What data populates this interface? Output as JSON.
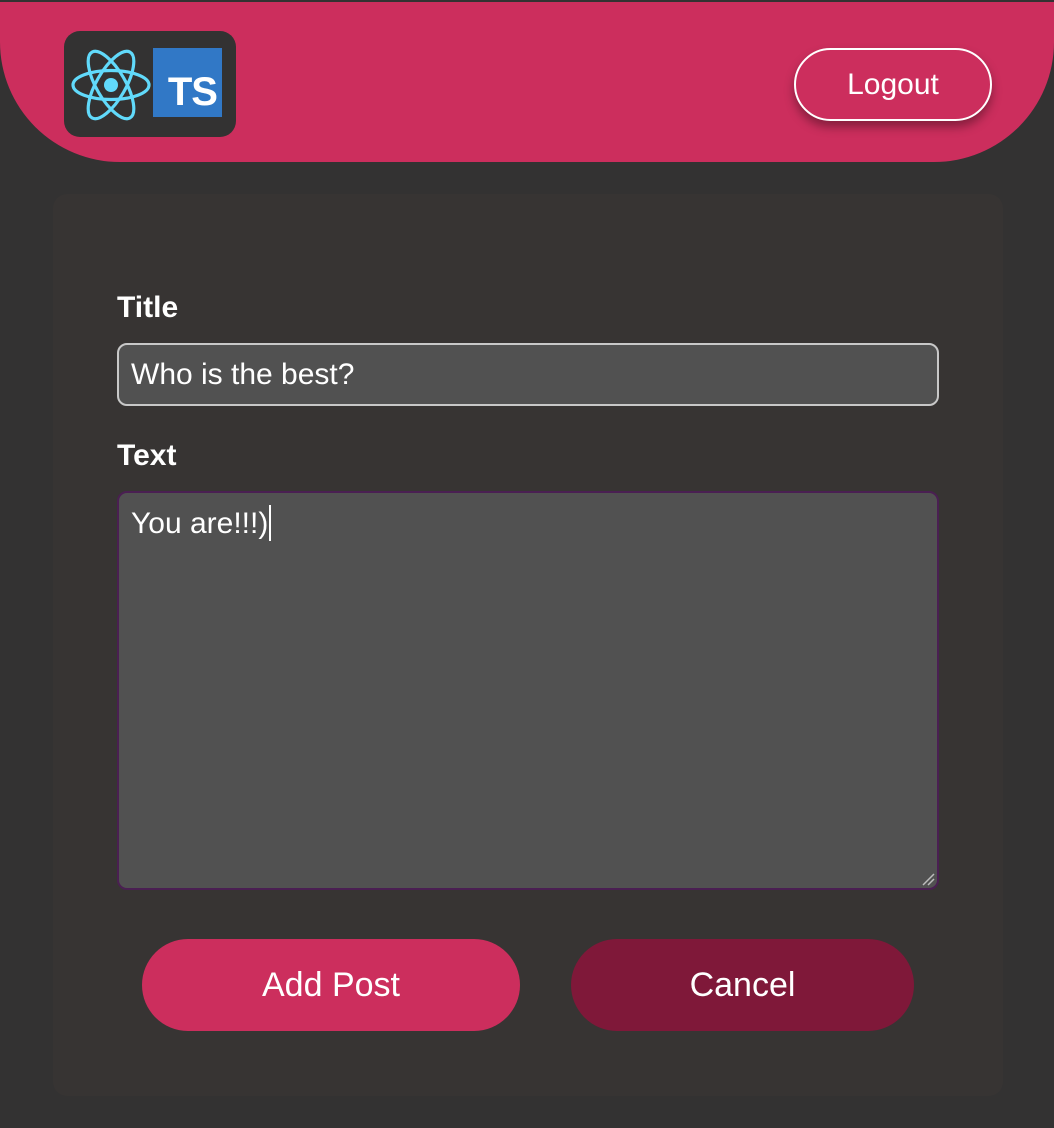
{
  "header": {
    "logo": {
      "react_icon": "react-icon",
      "ts_label": "TS"
    },
    "logout_label": "Logout"
  },
  "form": {
    "title_label": "Title",
    "title_value": "Who is the best?",
    "text_label": "Text",
    "text_value": "You are!!!)",
    "add_label": "Add Post",
    "cancel_label": "Cancel"
  },
  "colors": {
    "background": "#333232",
    "header": "#cc2e5d",
    "card": "#373433",
    "field": "#515151",
    "add_button": "#cc2e5d",
    "cancel_button": "#7f1839",
    "react_cyan": "#61dafb",
    "ts_blue": "#3178c6"
  }
}
